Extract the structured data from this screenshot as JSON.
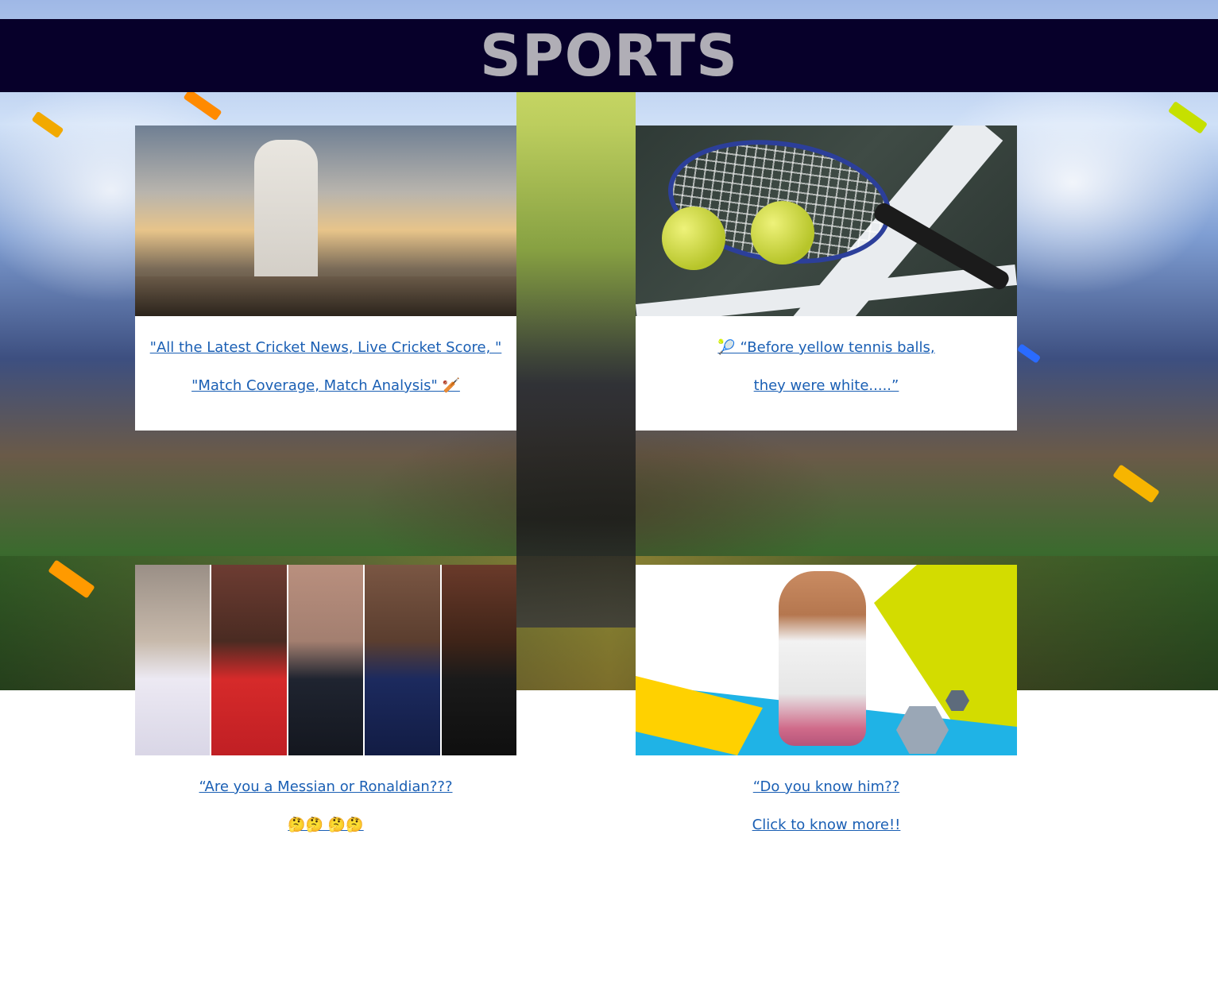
{
  "header": {
    "title": "SPORTS"
  },
  "cards": [
    {
      "id": "cricket",
      "line1": "\"All the Latest Cricket News, Live Cricket Score, \"",
      "line2": "\"Match Coverage, Match Analysis\" 🏏"
    },
    {
      "id": "tennis",
      "line1": "🎾 “Before yellow tennis balls,",
      "line2": "they were white.....”"
    },
    {
      "id": "football",
      "line1": "“Are you a Messian or Ronaldian???",
      "line2": "🤔🤔 🤔🤔"
    },
    {
      "id": "mascot",
      "line1": "“Do you know him??",
      "line2": "Click to know more!!"
    }
  ],
  "colors": {
    "header_bg": "#07002a",
    "header_text": "#b0aeb6",
    "link": "#1a5fb4"
  },
  "icons": [
    "cricket-photo",
    "tennis-photo",
    "football-players-photo",
    "mascot-photo"
  ]
}
